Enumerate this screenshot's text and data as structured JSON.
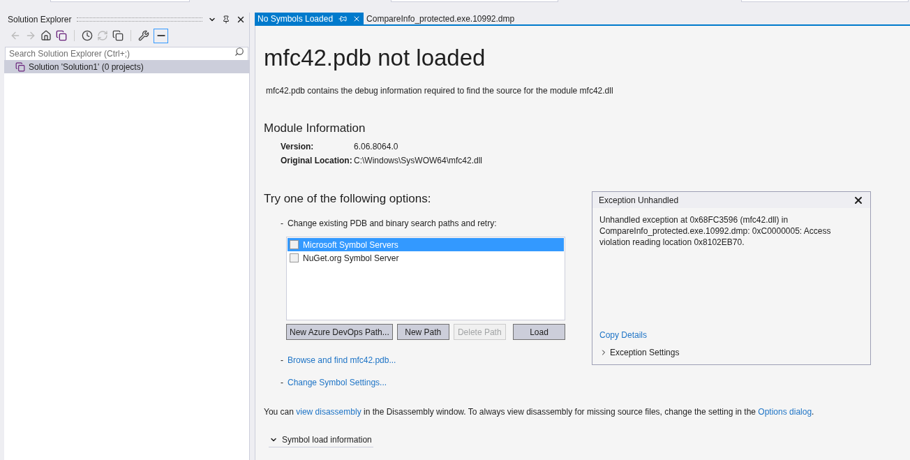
{
  "solution_explorer": {
    "title": "Solution Explorer",
    "search": {
      "placeholder": "Search Solution Explorer (Ctrl+;)"
    },
    "tree": [
      {
        "label": "Solution 'Solution1' (0 projects)",
        "selected": true
      }
    ]
  },
  "tabs": [
    {
      "label": "No Symbols Loaded",
      "selected": true
    },
    {
      "label": "CompareInfo_protected.exe.10992.dmp",
      "selected": false
    }
  ],
  "page": {
    "title": "mfc42.pdb not loaded",
    "description": "mfc42.pdb contains the debug information required to find the source for the module mfc42.dll",
    "module_heading": "Module Information",
    "module_info": [
      {
        "label": "Version:",
        "value": "6.06.8064.0"
      },
      {
        "label": "Original Location:",
        "value": "C:\\Windows\\SysWOW64\\mfc42.dll"
      }
    ],
    "options_heading": "Try one of the following options:",
    "change_paths": {
      "bullet": "-",
      "label": "Change existing PDB and binary search paths and retry:"
    },
    "symbol_servers": [
      {
        "label": "Microsoft Symbol Servers",
        "checked": false,
        "selected": true
      },
      {
        "label": "NuGet.org Symbol Server",
        "checked": false,
        "selected": false
      }
    ],
    "buttons": [
      {
        "label": "New Azure DevOps Path...",
        "disabled": false
      },
      {
        "label": "New Path",
        "disabled": false
      },
      {
        "label": "Delete Path",
        "disabled": true
      },
      {
        "label": "Load",
        "disabled": false
      }
    ],
    "links": [
      {
        "bullet": "-",
        "label": "Browse and find mfc42.pdb..."
      },
      {
        "bullet": "-",
        "label": "Change Symbol Settings..."
      }
    ],
    "footer": {
      "before": "You can ",
      "link1": "view disassembly",
      "middle": " in the Disassembly window. To always view disassembly for missing source files, change the setting in the ",
      "link2": "Options dialog",
      "after": "."
    },
    "symbol_load_info": {
      "label": "Symbol load information",
      "expanded": true
    }
  },
  "exception": {
    "title": "Exception Unhandled",
    "message": "Unhandled exception at 0x68FC3596 (mfc42.dll) in CompareInfo_protected.exe.10992.dmp: 0xC0000005: Access violation reading location 0x8102EB70.",
    "copy_link": "Copy Details",
    "settings": {
      "label": "Exception Settings",
      "expanded": false
    }
  }
}
